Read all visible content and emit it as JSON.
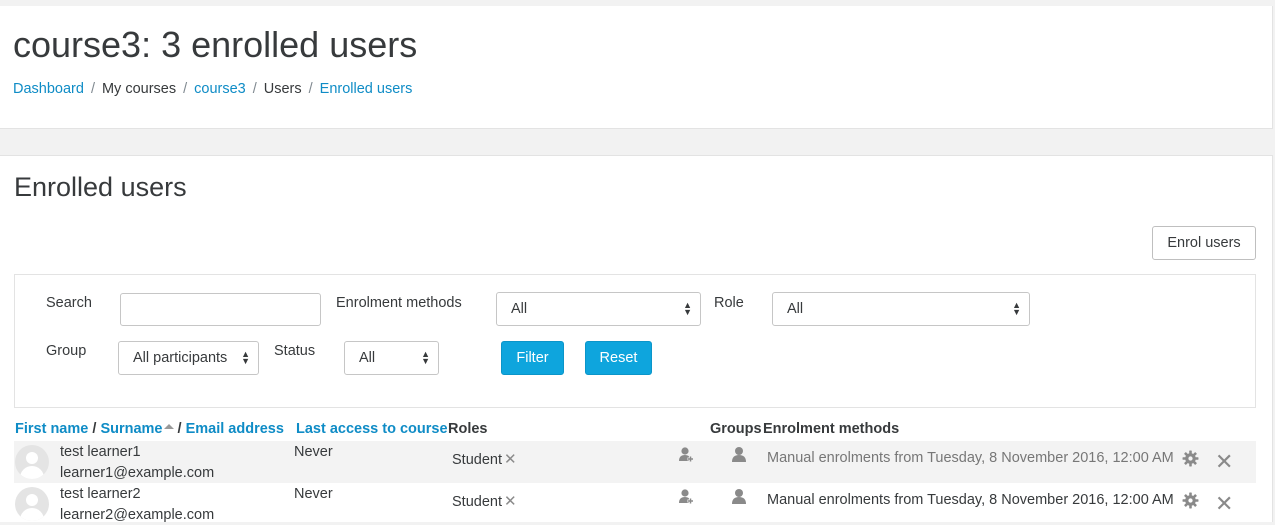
{
  "page": {
    "title": "course3: 3 enrolled users",
    "breadcrumb": [
      "Dashboard",
      "My courses",
      "course3",
      "Users",
      "Enrolled users"
    ]
  },
  "section": {
    "title": "Enrolled users",
    "enrol_button": "Enrol users"
  },
  "filters": {
    "search_label": "Search",
    "search_value": "",
    "enrolment_methods_label": "Enrolment methods",
    "enrolment_methods_value": "All",
    "role_label": "Role",
    "role_value": "All",
    "group_label": "Group",
    "group_value": "All participants",
    "status_label": "Status",
    "status_value": "All",
    "filter_button": "Filter",
    "reset_button": "Reset"
  },
  "table": {
    "headers": {
      "first_name": "First name",
      "sep1": " / ",
      "surname": "Surname",
      "sep2": " / ",
      "email": "Email address",
      "last_access": "Last access to course",
      "roles": "Roles",
      "groups": "Groups",
      "enrolment_methods": "Enrolment methods"
    },
    "rows": [
      {
        "name": "test learner1",
        "email": "learner1@example.com",
        "last_access": "Never",
        "role": "Student",
        "enrolment": "Manual enrolments from Tuesday, 8 November 2016, 12:00 AM",
        "enrolment_muted": true
      },
      {
        "name": "test learner2",
        "email": "learner2@example.com",
        "last_access": "Never",
        "role": "Student",
        "enrolment": "Manual enrolments from Tuesday, 8 November 2016, 12:00 AM",
        "enrolment_muted": false
      }
    ]
  },
  "colors": {
    "link": "#0f8cc6",
    "primary_button": "#0ea5dd",
    "text": "#373a3c",
    "muted_icon": "#8a8a8a"
  },
  "icons": [
    "sort-asc-icon",
    "remove-role-icon",
    "assign-role-icon",
    "groups-icon",
    "settings-gear-icon",
    "unenrol-icon",
    "user-avatar-icon",
    "select-caret-icon"
  ]
}
